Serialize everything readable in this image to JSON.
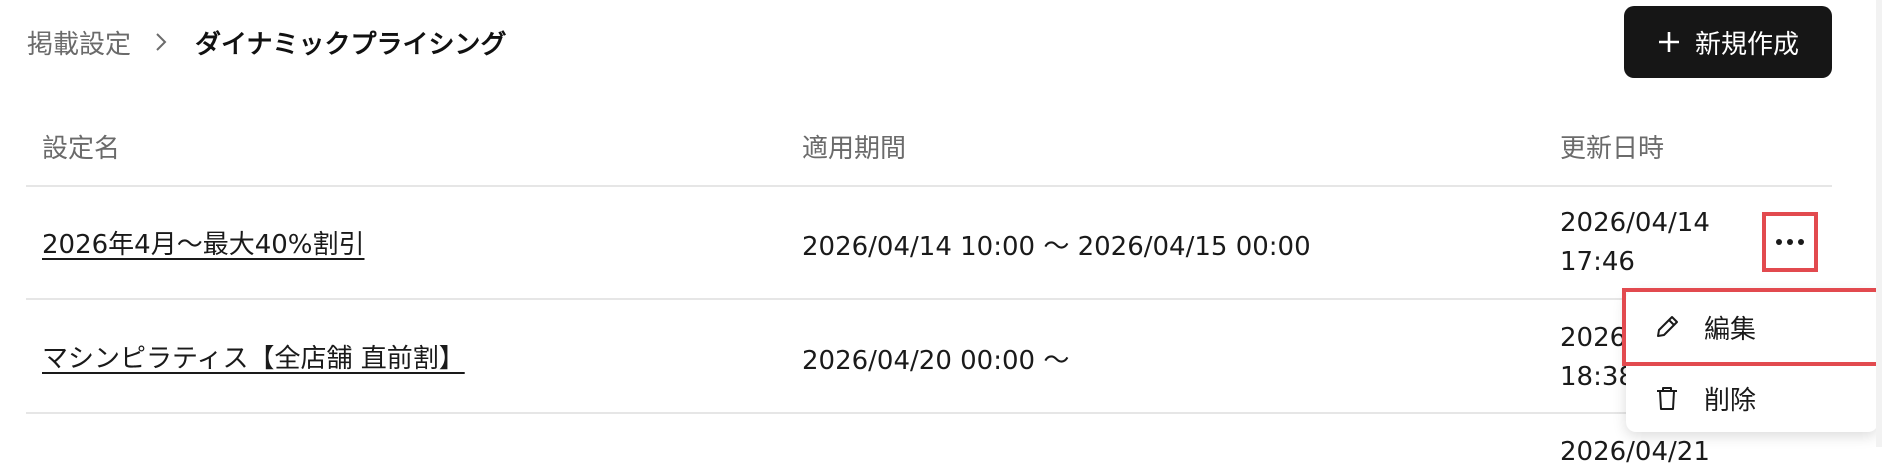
{
  "breadcrumb": {
    "parent": "掲載設定",
    "separator_icon": "chevron-right-icon",
    "current": "ダイナミックプライシング"
  },
  "toolbar": {
    "new_button_icon": "plus-icon",
    "new_button_label": "新規作成"
  },
  "table": {
    "columns": [
      "設定名",
      "適用期間",
      "更新日時"
    ],
    "rows": [
      {
        "name": "2026年4月〜最大40%割引",
        "period": "2026/04/14 10:00 〜 2026/04/15 00:00",
        "updated_date": "2026/04/14",
        "updated_time": "17:46"
      },
      {
        "name": "マシンピラティス【全店舗 直前割】",
        "period": "2026/04/20 00:00 〜",
        "updated_date": "2026",
        "updated_time": "18:38"
      },
      {
        "name": "",
        "period": "",
        "updated_date": "2026/04/21",
        "updated_time": ""
      }
    ]
  },
  "row_actions": {
    "more_icon": "more-horizontal-icon",
    "menu": [
      {
        "icon": "pencil-icon",
        "label": "編集"
      },
      {
        "icon": "trash-icon",
        "label": "削除"
      }
    ]
  },
  "colors": {
    "primary_button": "#161616",
    "highlight": "#e24a4f",
    "muted_text": "#6b6b6b",
    "divider": "#e6e6e6"
  }
}
